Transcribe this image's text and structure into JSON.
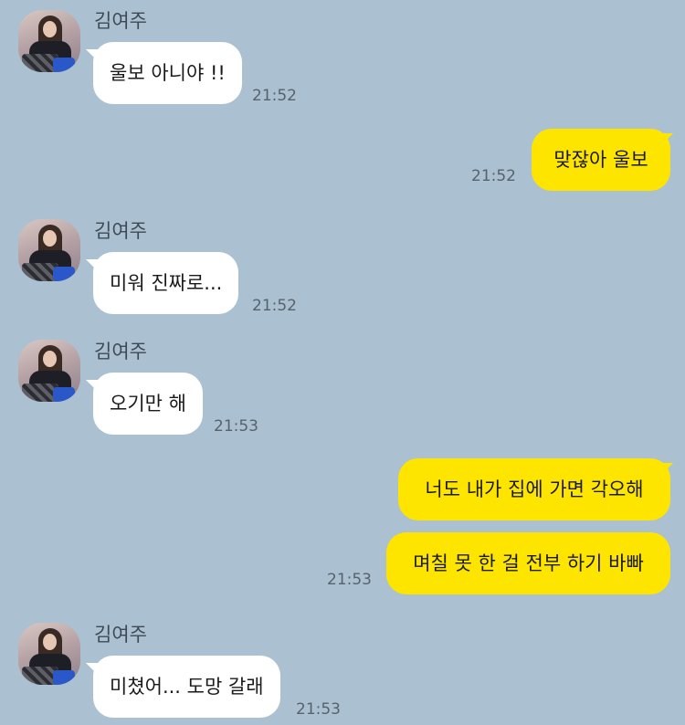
{
  "chat": {
    "contact_name": "김여주",
    "messages": [
      {
        "direction": "in",
        "text": "울보 아니야 !!",
        "time": "21:52"
      },
      {
        "direction": "out",
        "text": "맞잖아 울보",
        "time": "21:52"
      },
      {
        "direction": "in",
        "text": "미워 진짜로...",
        "time": "21:52"
      },
      {
        "direction": "in",
        "text": "오기만 해",
        "time": "21:53"
      },
      {
        "direction": "out",
        "text": "너도 내가 집에 가면 각오해",
        "time": ""
      },
      {
        "direction": "out",
        "text": "며칠 못 한 걸 전부 하기 바빠",
        "time": "21:53"
      },
      {
        "direction": "in",
        "text": "미쳤어... 도망 갈래",
        "time": "21:53"
      }
    ]
  },
  "colors": {
    "background": "#abc1d1",
    "incoming_bubble": "#ffffff",
    "outgoing_bubble": "#fee500",
    "timestamp": "#56636d"
  },
  "icons": {
    "avatar": "contact-profile-photo"
  }
}
